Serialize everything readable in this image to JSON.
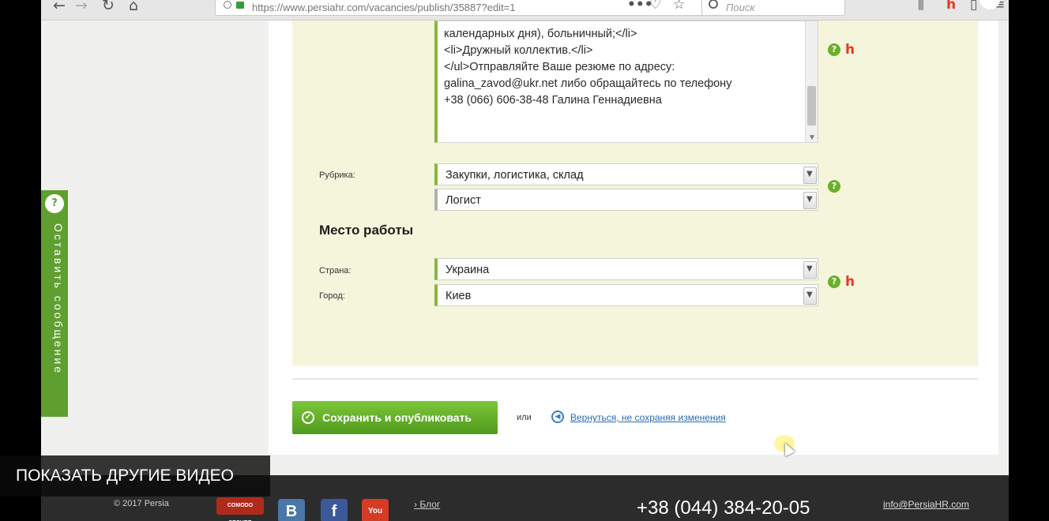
{
  "browser": {
    "url": "https://www.persiahr.com/vacancies/publish/35887?edit=1",
    "search_placeholder": "Поиск"
  },
  "description": {
    "lines": [
      "календарных дня), больничный;</li>",
      "<li>Дружный коллектив.</li>",
      "</ul>Отправляйте Ваше резюме по адресу:",
      "galina_zavod@ukr.net либо обращайтесь по телефону",
      "+38 (066) 606-38-48 Галина Геннадиевна"
    ]
  },
  "rubric": {
    "label": "Рубрика:",
    "category": "Закупки, логистика, склад",
    "subcategory": "Логист"
  },
  "workplace": {
    "title": "Место работы",
    "country_label": "Страна:",
    "country": "Украина",
    "city_label": "Город:",
    "city": "Киев"
  },
  "actions": {
    "save_label": "Сохранить и опубликовать",
    "or_label": "или",
    "back_label": "Вернуться, не сохраняя изменения"
  },
  "side_tab": {
    "label": "Оставить сообщение"
  },
  "footer": {
    "copyright": "© 2017 Persia",
    "blog": "Блог",
    "phone": "+38 (044) 384-20-05",
    "email": "info@PersiaHR.com",
    "comodo": "COMODO SECURE"
  },
  "video_overlay": {
    "label": "ПОКАЗАТЬ ДРУГИЕ ВИДЕО"
  },
  "colors": {
    "accent_green": "#6bb028",
    "panel_bg": "#f5f5dc",
    "link_blue": "#2b6bb3",
    "hh_red": "#e33a22"
  }
}
